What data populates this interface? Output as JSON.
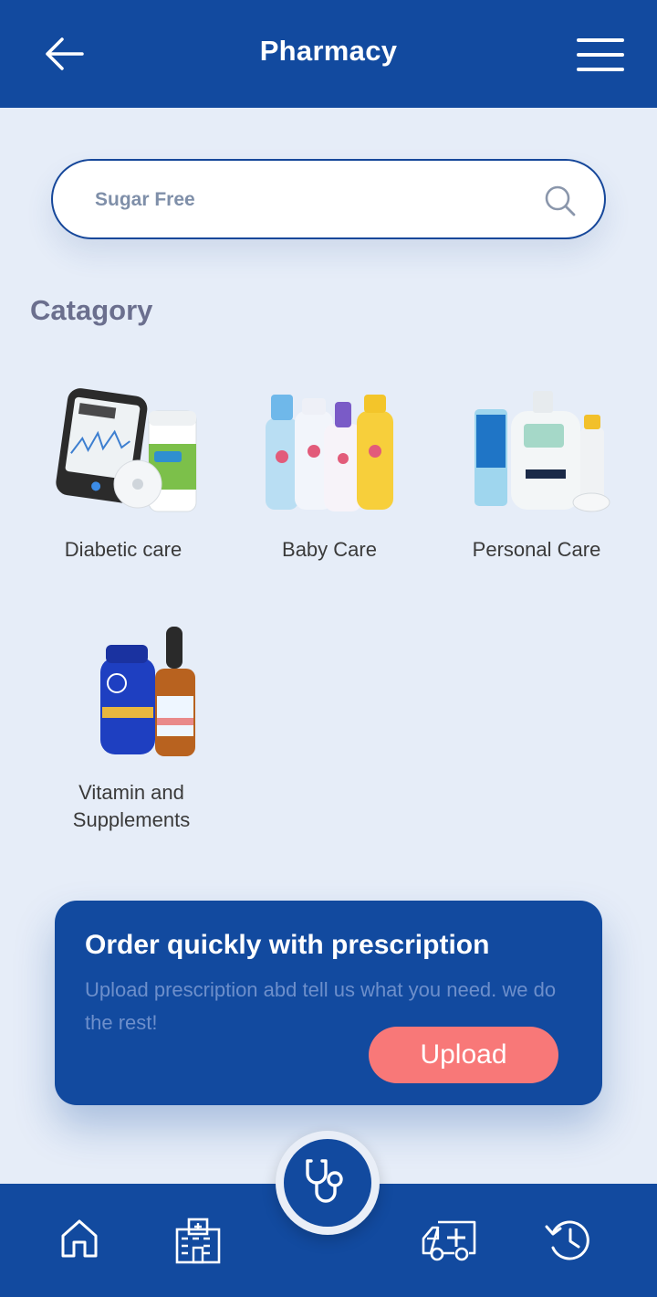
{
  "header": {
    "title": "Pharmacy",
    "back_icon": "arrow-left-icon",
    "menu_icon": "hamburger-menu-icon"
  },
  "search": {
    "placeholder": "Sugar Free",
    "icon": "search-icon"
  },
  "category": {
    "title": "Catagory",
    "items": [
      {
        "label": "Diabetic care",
        "icon": "glucose-monitor-image"
      },
      {
        "label": "Baby Care",
        "icon": "baby-products-image"
      },
      {
        "label": "Personal Care",
        "icon": "skincare-products-image"
      },
      {
        "label": "Vitamin and Supplements",
        "icon": "vitamin-bottles-image"
      }
    ]
  },
  "promo": {
    "title": "Order quickly with prescription",
    "text": "Upload prescription abd tell us what you need. we do the rest!",
    "button": "Upload"
  },
  "bottom_nav": {
    "items": [
      "home-icon",
      "hospital-icon",
      "stethoscope-icon",
      "ambulance-icon",
      "history-icon"
    ]
  },
  "colors": {
    "primary": "#124a9f",
    "background": "#e6edf8",
    "accent": "#f87878",
    "muted_text": "#6b6f8e"
  }
}
